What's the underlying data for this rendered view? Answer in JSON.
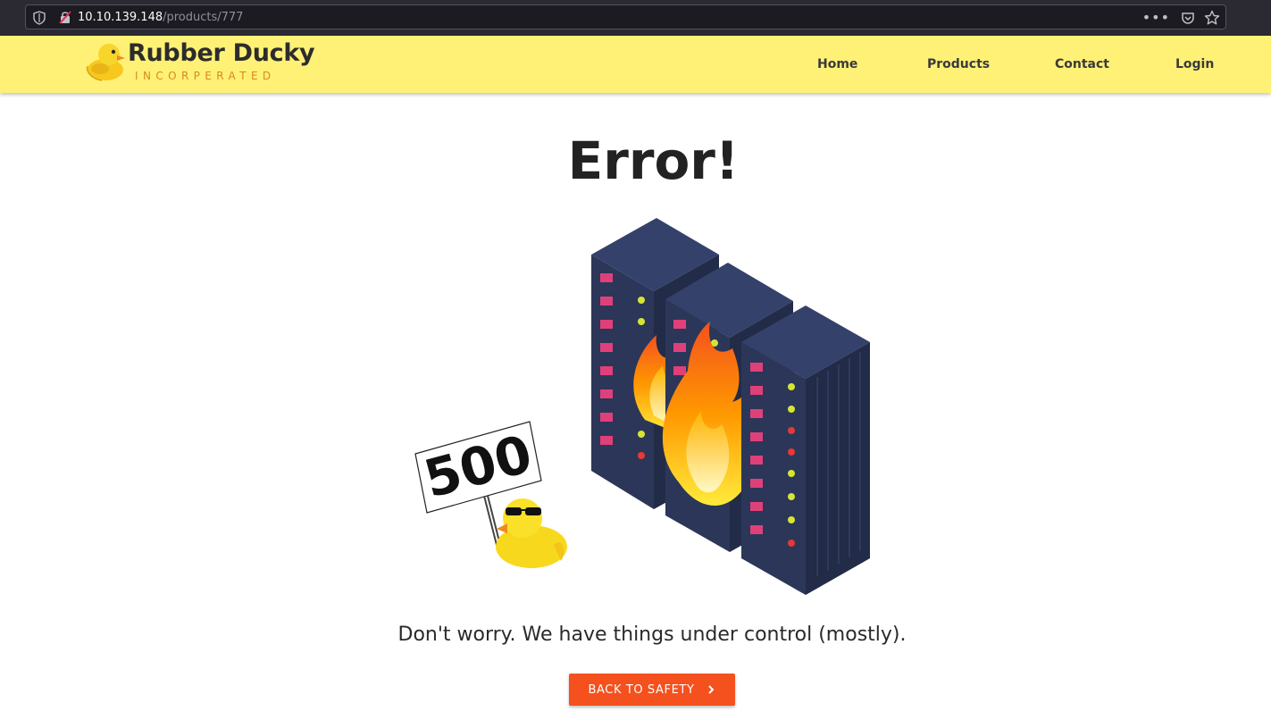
{
  "browser": {
    "url_host": "10.10.139.148",
    "url_path": "/products/777",
    "icons": [
      "shield-icon",
      "insecure-lock-icon",
      "page-actions-icon",
      "pocket-icon",
      "bookmark-star-icon"
    ]
  },
  "header": {
    "logo_title": "Rubber Ducky",
    "logo_subtitle": "INCORPERATED",
    "background_color": "#fff176",
    "nav": [
      {
        "label": "Home"
      },
      {
        "label": "Products"
      },
      {
        "label": "Contact"
      },
      {
        "label": "Login"
      }
    ]
  },
  "main": {
    "title": "Error!",
    "sign_text": "500",
    "message": "Don't worry. We have things under control (mostly).",
    "button_label": "BACK TO SAFETY",
    "button_color": "#f4511e"
  }
}
